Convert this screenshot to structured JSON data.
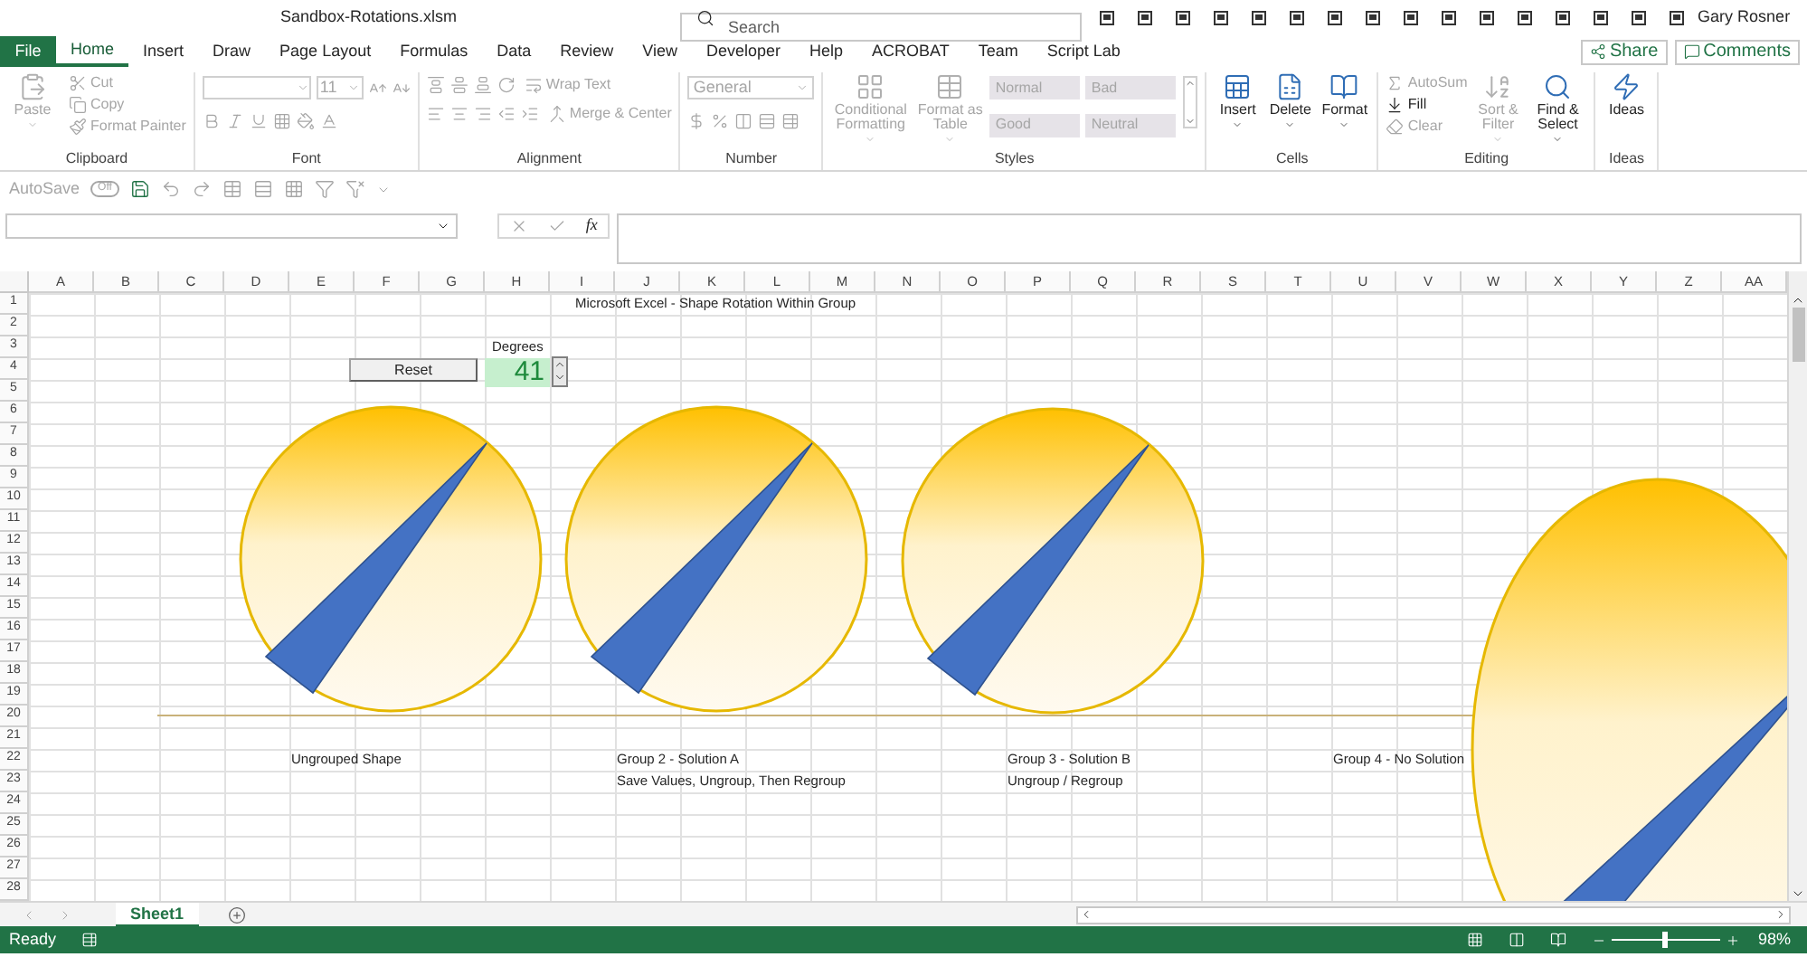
{
  "title_bar": {
    "file_name": "Sandbox-Rotations.xlsm",
    "search_placeholder": "Search",
    "user_name": "Gary Rosner"
  },
  "tabs": [
    {
      "label": "File",
      "kind": "file",
      "selected": false
    },
    {
      "label": "Home",
      "kind": "tab",
      "selected": true
    },
    {
      "label": "Insert",
      "kind": "tab",
      "selected": false
    },
    {
      "label": "Draw",
      "kind": "tab",
      "selected": false
    },
    {
      "label": "Page Layout",
      "kind": "tab",
      "selected": false
    },
    {
      "label": "Formulas",
      "kind": "tab",
      "selected": false
    },
    {
      "label": "Data",
      "kind": "tab",
      "selected": false
    },
    {
      "label": "Review",
      "kind": "tab",
      "selected": false
    },
    {
      "label": "View",
      "kind": "tab",
      "selected": false
    },
    {
      "label": "Developer",
      "kind": "tab",
      "selected": false
    },
    {
      "label": "Help",
      "kind": "tab",
      "selected": false
    },
    {
      "label": "ACROBAT",
      "kind": "tab",
      "selected": false
    },
    {
      "label": "Team",
      "kind": "tab",
      "selected": false
    },
    {
      "label": "Script Lab",
      "kind": "tab",
      "selected": false
    }
  ],
  "share_button": "Share",
  "comments_button": "Comments",
  "ribbon": [
    {
      "kind": "clipboard",
      "label": "Clipboard",
      "items": [
        {
          "label": "Paste",
          "disabled": true
        },
        {
          "label": "Cut",
          "disabled": true
        },
        {
          "label": "Copy",
          "disabled": true
        },
        {
          "label": "Format Painter",
          "disabled": true
        }
      ]
    },
    {
      "kind": "font",
      "label": "Font",
      "items": [
        {
          "label": "11",
          "disabled": true
        }
      ]
    },
    {
      "kind": "alignment",
      "label": "Alignment",
      "items": [
        {
          "label": "Wrap Text",
          "disabled": true
        },
        {
          "label": "Merge & Center",
          "disabled": true
        }
      ]
    },
    {
      "kind": "number",
      "label": "Number",
      "items": [
        {
          "label": "General",
          "disabled": true
        }
      ]
    },
    {
      "kind": "styles",
      "label": "Styles",
      "items": [
        {
          "label": "Conditional Formatting",
          "disabled": true
        },
        {
          "label": "Format as Table",
          "disabled": true
        },
        {
          "label": "Normal",
          "disabled": true
        },
        {
          "label": "Bad",
          "disabled": true
        },
        {
          "label": "Good",
          "disabled": true
        },
        {
          "label": "Neutral",
          "disabled": true
        }
      ]
    },
    {
      "kind": "cells",
      "label": "Cells",
      "items": [
        {
          "label": "Insert",
          "disabled": false
        },
        {
          "label": "Delete",
          "disabled": false
        },
        {
          "label": "Format",
          "disabled": false
        }
      ]
    },
    {
      "kind": "editing",
      "label": "Editing",
      "items": [
        {
          "label": "AutoSum",
          "disabled": true
        },
        {
          "label": "Fill",
          "disabled": false
        },
        {
          "label": "Clear",
          "disabled": true
        },
        {
          "label": "Sort & Filter",
          "disabled": true
        },
        {
          "label": "Find & Select",
          "disabled": false
        }
      ]
    },
    {
      "kind": "ideas",
      "label": "Ideas",
      "items": [
        {
          "label": "Ideas",
          "disabled": false
        }
      ]
    }
  ],
  "quick_access": {
    "autosave_label": "AutoSave",
    "autosave_state": "Off"
  },
  "formula_bar": {
    "function_label": "fx"
  },
  "sheet": {
    "columns": [
      "A",
      "B",
      "C",
      "D",
      "E",
      "F",
      "G",
      "H",
      "I",
      "J",
      "K",
      "L",
      "M",
      "N",
      "O",
      "P",
      "Q",
      "R",
      "S",
      "T",
      "U",
      "V",
      "W",
      "X",
      "Y",
      "Z",
      "AA"
    ],
    "rows": [
      "1",
      "2",
      "3",
      "4",
      "5",
      "6",
      "7",
      "8",
      "9",
      "10",
      "11",
      "12",
      "13",
      "14",
      "15",
      "16",
      "17",
      "18",
      "19",
      "20",
      "21",
      "22",
      "23",
      "24",
      "25",
      "26",
      "27",
      "28"
    ],
    "title": "Microsoft Excel - Shape Rotation Within Group",
    "degrees_label": "Degrees",
    "degrees_value": "41",
    "reset_button": "Reset",
    "shapes": [
      {
        "kind": "circle",
        "caption": [
          "Ungrouped Shape"
        ]
      },
      {
        "kind": "circle",
        "caption": [
          "Group 2 - Solution A",
          "Save Values, Ungroup, Then Regroup"
        ]
      },
      {
        "kind": "circle",
        "caption": [
          "Group 3 - Solution B",
          "Ungroup / Regroup"
        ]
      },
      {
        "kind": "ellipse",
        "caption": [
          "Group 4 - No Solution"
        ]
      }
    ]
  },
  "sheet_tabs": [
    {
      "label": "Sheet1",
      "selected": true
    }
  ],
  "status_bar": {
    "status": "Ready",
    "zoom": "98%",
    "zoom_slider": {
      "level": 0.48
    }
  }
}
